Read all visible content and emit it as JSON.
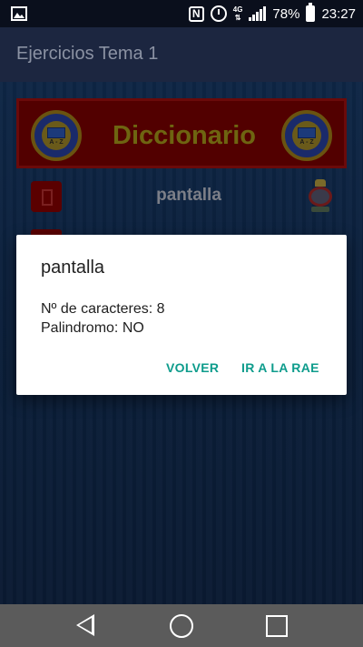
{
  "status_bar": {
    "battery": "78%",
    "time": "23:27",
    "network": "4G"
  },
  "app_bar": {
    "title": "Ejercicios Tema 1"
  },
  "banner": {
    "title": "Diccionario",
    "logo_text": "A - Z"
  },
  "word_row": {
    "word": "pantalla"
  },
  "dialog": {
    "title": "pantalla",
    "char_count_line": "Nº de caracteres: 8",
    "palindrome_line": "Palindromo: NO",
    "volver_label": "VOLVER",
    "rae_label": "IR A LA RAE"
  },
  "colors": {
    "accent": "#0e9c8c",
    "banner_bg": "#520000",
    "app_bar_bg": "#1c2640"
  }
}
